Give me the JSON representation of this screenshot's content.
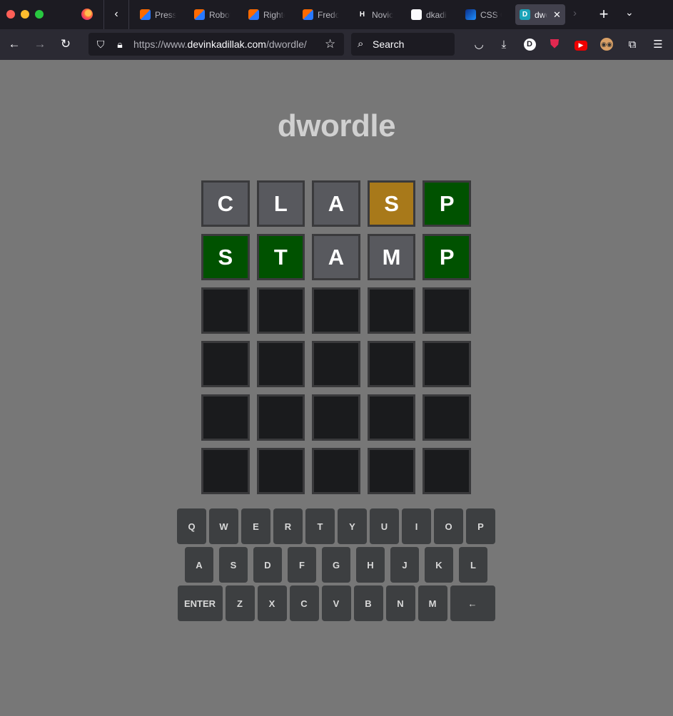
{
  "browser": {
    "tabs": [
      {
        "label": "Press",
        "favicon": "yb"
      },
      {
        "label": "Robot",
        "favicon": "yb"
      },
      {
        "label": "Righte",
        "favicon": "yb"
      },
      {
        "label": "Fredol",
        "favicon": "yb"
      },
      {
        "label": "Novice",
        "favicon": "H"
      },
      {
        "label": "dkadil",
        "favicon": "github"
      },
      {
        "label": "CSS G",
        "favicon": "css"
      },
      {
        "label": "dwo",
        "favicon": "D",
        "active": true
      }
    ],
    "url_prefix": "https://www.",
    "url_host": "devinkadillak.com",
    "url_path": "/dwordle/",
    "search_placeholder": "Search",
    "ext_d_letter": "D"
  },
  "game": {
    "title": "dwordle",
    "colors": {
      "absent": "#58595e",
      "present": "#a8791a",
      "correct": "#005200",
      "empty": "#1a1b1d"
    },
    "rows": [
      {
        "letters": [
          "C",
          "L",
          "A",
          "S",
          "P"
        ],
        "states": [
          "absent",
          "absent",
          "absent",
          "present",
          "correct"
        ]
      },
      {
        "letters": [
          "S",
          "T",
          "A",
          "M",
          "P"
        ],
        "states": [
          "correct",
          "correct",
          "absent",
          "absent",
          "correct"
        ]
      },
      {
        "letters": [
          "",
          "",
          "",
          "",
          ""
        ],
        "states": [
          "empty",
          "empty",
          "empty",
          "empty",
          "empty"
        ]
      },
      {
        "letters": [
          "",
          "",
          "",
          "",
          ""
        ],
        "states": [
          "empty",
          "empty",
          "empty",
          "empty",
          "empty"
        ]
      },
      {
        "letters": [
          "",
          "",
          "",
          "",
          ""
        ],
        "states": [
          "empty",
          "empty",
          "empty",
          "empty",
          "empty"
        ]
      },
      {
        "letters": [
          "",
          "",
          "",
          "",
          ""
        ],
        "states": [
          "empty",
          "empty",
          "empty",
          "empty",
          "empty"
        ]
      }
    ]
  },
  "keyboard": {
    "row1": [
      "Q",
      "W",
      "E",
      "R",
      "T",
      "Y",
      "U",
      "I",
      "O",
      "P"
    ],
    "row2": [
      "A",
      "S",
      "D",
      "F",
      "G",
      "H",
      "J",
      "K",
      "L"
    ],
    "row3": [
      "ENTER",
      "Z",
      "X",
      "C",
      "V",
      "B",
      "N",
      "M",
      "←"
    ]
  }
}
